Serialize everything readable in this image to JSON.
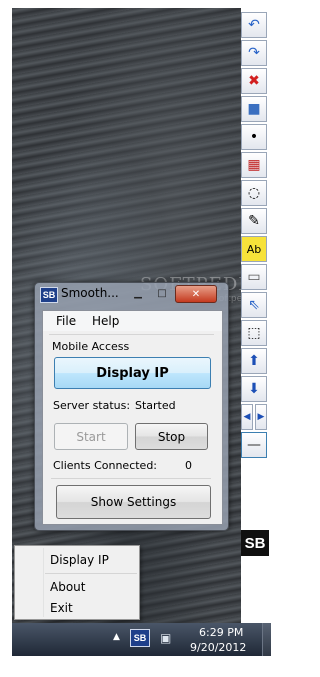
{
  "watermark": {
    "text": "SOFTPEDIA",
    "url": "www.softpedia.com"
  },
  "app": {
    "icon_text": "SB",
    "title": "Smooth...",
    "menu": [
      "File",
      "Help"
    ],
    "group_title": "Mobile Access",
    "display_ip_label": "Display IP",
    "server_status_label": "Server status:",
    "server_status_value": "Started",
    "start_label": "Start",
    "stop_label": "Stop",
    "clients_label": "Clients Connected:",
    "clients_value": "0",
    "show_settings_label": "Show Settings"
  },
  "toolbar": {
    "logo_text": "SB",
    "tools": [
      {
        "name": "undo-icon",
        "glyph": "↶",
        "color": "#2a64c8"
      },
      {
        "name": "redo-icon",
        "glyph": "↷",
        "color": "#2a64c8"
      },
      {
        "name": "clear-icon",
        "glyph": "✖",
        "color": "#d21f1f"
      },
      {
        "name": "rectangle-icon",
        "glyph": "■",
        "color": "#3a6fc0"
      },
      {
        "name": "dot-icon",
        "glyph": "•",
        "color": "#000000"
      },
      {
        "name": "color-palette-icon",
        "glyph": "▦",
        "color": "#c02020"
      },
      {
        "name": "lasso-icon",
        "glyph": "◌",
        "color": "#000000"
      },
      {
        "name": "pen-icon",
        "glyph": "✎",
        "color": "#000000"
      },
      {
        "name": "text-icon",
        "glyph": "Ab",
        "color": "#000000"
      },
      {
        "name": "eraser-icon",
        "glyph": "▭",
        "color": "#555555"
      },
      {
        "name": "pointer-icon",
        "glyph": "⇖",
        "color": "#2a64c8"
      },
      {
        "name": "select-region-icon",
        "glyph": "⬚",
        "color": "#000000"
      },
      {
        "name": "arrow-up-icon",
        "glyph": "⬆",
        "color": "#1c4fb6"
      },
      {
        "name": "arrow-down-icon",
        "glyph": "⬇",
        "color": "#1c4fb6"
      }
    ],
    "half_tools": [
      {
        "name": "arrow-left-icon",
        "glyph": "◀",
        "color": "#1c4fb6"
      },
      {
        "name": "arrow-right-icon",
        "glyph": "▶",
        "color": "#1c4fb6"
      }
    ],
    "minimize_tool": {
      "name": "minimize-toolbar-icon",
      "glyph": "—",
      "color": "#333333"
    }
  },
  "context_menu": {
    "items": [
      "Display IP",
      "About",
      "Exit"
    ]
  },
  "taskbar": {
    "tray_arrow": "▲",
    "tray_app_text": "SB",
    "network_glyph": "▣",
    "time": "6:29 PM",
    "date": "9/20/2012"
  }
}
